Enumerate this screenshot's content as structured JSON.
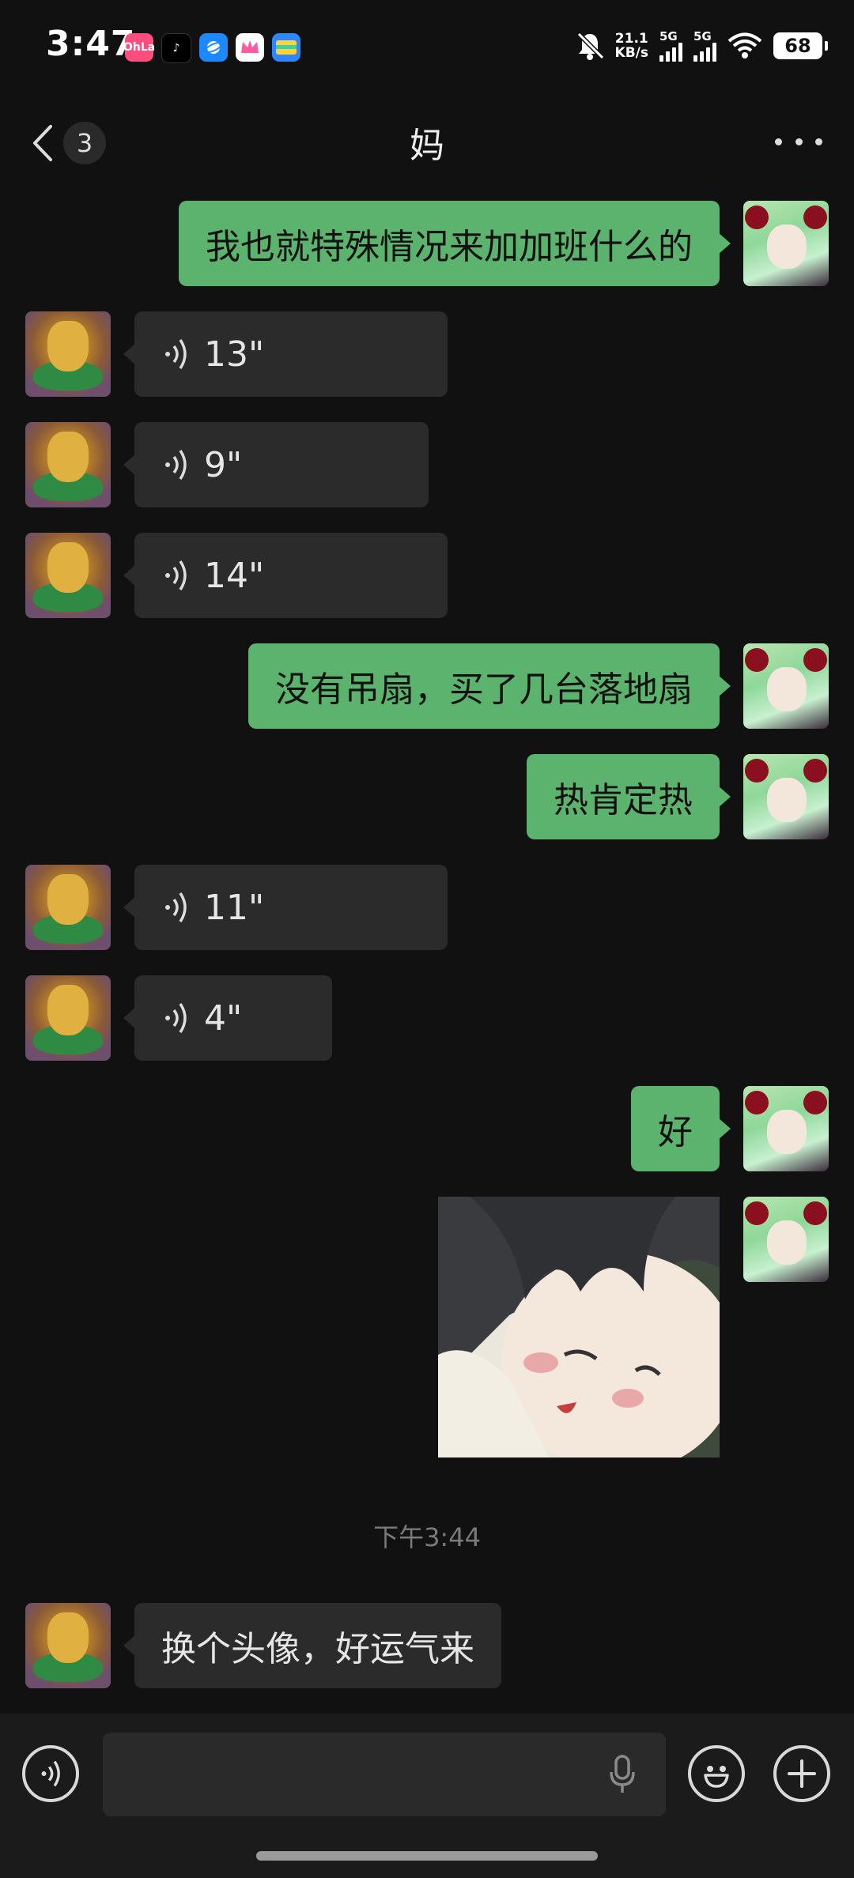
{
  "status_bar": {
    "time": "3:47",
    "app_icons": [
      "ohla-app-icon",
      "tiktok-app-icon",
      "browser-app-icon",
      "crown-app-icon",
      "wallet-app-icon"
    ],
    "app_icon_labels": [
      "OhLa",
      "♪",
      "",
      "",
      ""
    ],
    "net_speed_value": "21.1",
    "net_speed_unit": "KB/s",
    "sim1_label": "5G",
    "sim2_label": "5G",
    "battery": "68"
  },
  "header": {
    "back_count": "3",
    "title": "妈"
  },
  "messages": [
    {
      "side": "out",
      "type": "text",
      "text": "我也就特殊情况来加加班什么的"
    },
    {
      "side": "in",
      "type": "voice",
      "duration": "13\""
    },
    {
      "side": "in",
      "type": "voice",
      "duration": "9\""
    },
    {
      "side": "in",
      "type": "voice",
      "duration": "14\""
    },
    {
      "side": "out",
      "type": "text",
      "text": "没有吊扇，买了几台落地扇"
    },
    {
      "side": "out",
      "type": "text",
      "text": "热肯定热"
    },
    {
      "side": "in",
      "type": "voice",
      "duration": "11\""
    },
    {
      "side": "in",
      "type": "voice",
      "duration": "4\""
    },
    {
      "side": "out",
      "type": "text",
      "text": "好"
    },
    {
      "side": "out",
      "type": "image"
    },
    {
      "side": "in",
      "type": "text",
      "text": "换个头像，好运气来"
    }
  ],
  "timestamp": "下午3:44",
  "input_bar": {
    "placeholder": ""
  },
  "colors": {
    "background": "#111111",
    "outgoing_bubble": "#5bb36d",
    "incoming_bubble": "#2b2b2b"
  }
}
